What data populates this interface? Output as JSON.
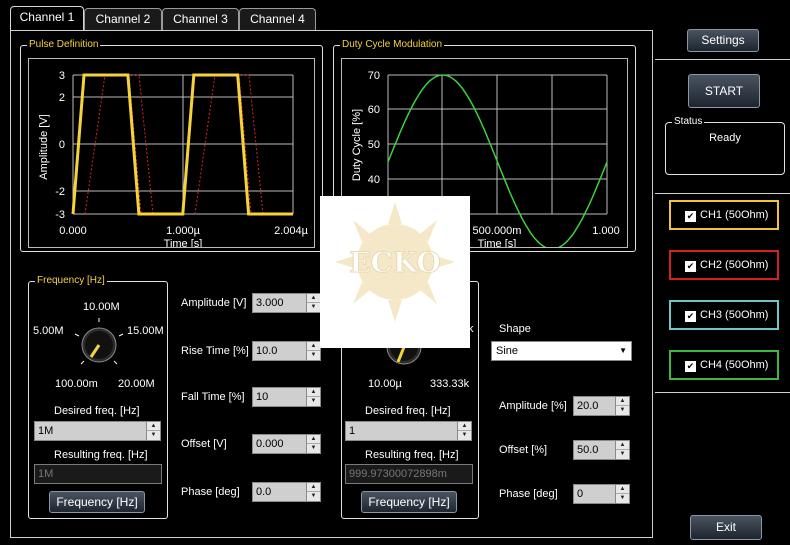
{
  "tabs": [
    {
      "label": "Channel 1",
      "active": true
    },
    {
      "label": "Channel 2",
      "active": false
    },
    {
      "label": "Channel 3",
      "active": false
    },
    {
      "label": "Channel 4",
      "active": false
    }
  ],
  "pulse_definition": {
    "title": "Pulse Definition",
    "ylabel": "Amplitude [V]",
    "xlabel": "Time [s]",
    "y_ticks": [
      "3",
      "2",
      "0",
      "-2",
      "-3"
    ],
    "x_ticks": [
      "0.000",
      "1.000µ",
      "2.004µ"
    ]
  },
  "duty_cycle_modulation": {
    "title": "Duty Cycle Modulation",
    "ylabel": "Duty Cycle [%]",
    "xlabel": "Time [s]",
    "y_ticks": [
      "70",
      "60",
      "50",
      "40"
    ],
    "x_ticks": [
      "500.000m",
      "1.000"
    ]
  },
  "chart_data": [
    {
      "type": "line",
      "title": "Pulse Definition",
      "xlabel": "Time [s]",
      "ylabel": "Amplitude [V]",
      "xlim": [
        0,
        2.004e-06
      ],
      "ylim": [
        -3,
        3
      ],
      "series": [
        {
          "x": [
            0,
            1e-07,
            5e-07,
            6e-07,
            1e-06,
            1.1e-06,
            1.5e-06,
            1.6e-06,
            2.004e-06
          ],
          "y": [
            -3,
            3,
            3,
            -3,
            -3,
            3,
            3,
            -3,
            -3
          ]
        }
      ]
    },
    {
      "type": "line",
      "title": "Duty Cycle Modulation",
      "xlabel": "Time [s]",
      "ylabel": "Duty Cycle [%]",
      "xlim": [
        0,
        1.0
      ],
      "ylim": [
        30,
        70
      ],
      "series": [
        {
          "function": "sine",
          "offset": 50,
          "amplitude": 20,
          "frequency": 1
        }
      ]
    }
  ],
  "frequency_panel": {
    "title": "Frequency [Hz]",
    "knob_labels": {
      "top": "10.00M",
      "left": "5.00M",
      "right": "15.00M",
      "bottom_left": "100.00m",
      "bottom_right": "20.00M"
    },
    "desired_label": "Desired freq. [Hz]",
    "desired_value": "1M",
    "resulting_label": "Resulting freq. [Hz]",
    "resulting_value": "1M",
    "button_label": "Frequency [Hz]"
  },
  "pulse_params": {
    "amplitude_label": "Amplitude [V]",
    "amplitude_value": "3.000",
    "rise_label": "Rise Time [%]",
    "rise_value": "10.0",
    "fall_label": "Fall Time [%]",
    "fall_value": "10",
    "offset_label": "Offset [V]",
    "offset_value": "0.000",
    "phase_label": "Phase [deg]",
    "phase_value": "0.0"
  },
  "mod_frequency_panel": {
    "knob_labels": {
      "right_partial": "k",
      "bottom_left": "10.00µ",
      "bottom_right": "333.33k"
    },
    "desired_label": "Desired freq. [Hz]",
    "desired_value": "1",
    "resulting_label": "Resulting freq. [Hz]",
    "resulting_value": "999.97300072898m",
    "button_label": "Frequency [Hz]"
  },
  "mod_params": {
    "shape_label": "Shape",
    "shape_value": "Sine",
    "amplitude_label": "Amplitude [%]",
    "amplitude_value": "20.0",
    "offset_label": "Offset [%]",
    "offset_value": "50.0",
    "phase_label": "Phase [deg]",
    "phase_value": "0"
  },
  "sidebar": {
    "settings_label": "Settings",
    "start_label": "START",
    "status_title": "Status",
    "status_value": "Ready",
    "channels": [
      {
        "label": "CH1 (50Ohm)",
        "checked": true,
        "color": "#f0c53a"
      },
      {
        "label": "CH2 (50Ohm)",
        "checked": true,
        "color": "#d62020"
      },
      {
        "label": "CH3 (50Ohm)",
        "checked": true,
        "color": "#6fc6c8"
      },
      {
        "label": "CH4 (50Ohm)",
        "checked": true,
        "color": "#3fb83f"
      }
    ],
    "exit_label": "Exit"
  },
  "overlay_logo": {
    "text": "ECKO"
  }
}
